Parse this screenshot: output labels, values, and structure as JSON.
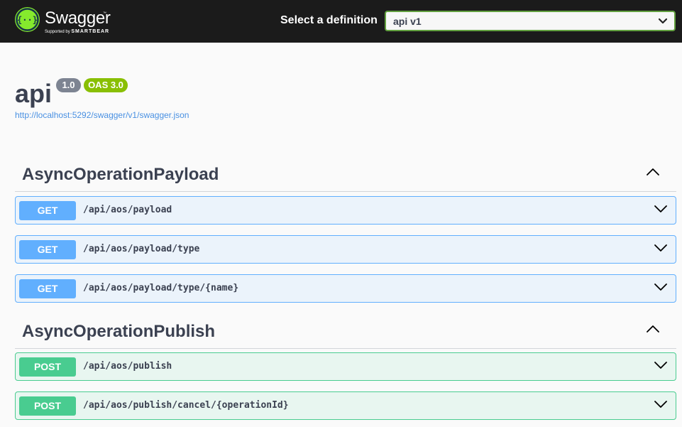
{
  "header": {
    "brand_name": "Swagger",
    "brand_tm": "™",
    "brand_sub_prefix": "Supported by",
    "brand_sub_company": "SMARTBEAR",
    "definition_label": "Select a definition",
    "definition_selected": "api v1",
    "brand_color": "#85ea2d",
    "logo_icon": "curly-braces-icon"
  },
  "info": {
    "title": "api",
    "version": "1.0",
    "oas_version": "OAS 3.0",
    "spec_url": "http://localhost:5292/swagger/v1/swagger.json"
  },
  "tags": [
    {
      "name": "AsyncOperationPayload",
      "operations": [
        {
          "method": "GET",
          "path": "/api/aos/payload"
        },
        {
          "method": "GET",
          "path": "/api/aos/payload/type"
        },
        {
          "method": "GET",
          "path": "/api/aos/payload/type/{name}"
        }
      ]
    },
    {
      "name": "AsyncOperationPublish",
      "operations": [
        {
          "method": "POST",
          "path": "/api/aos/publish"
        },
        {
          "method": "POST",
          "path": "/api/aos/publish/cancel/{operationId}"
        }
      ]
    }
  ],
  "colors": {
    "get": "#61affe",
    "post": "#49cc90",
    "topbar": "#1b1b1b"
  }
}
